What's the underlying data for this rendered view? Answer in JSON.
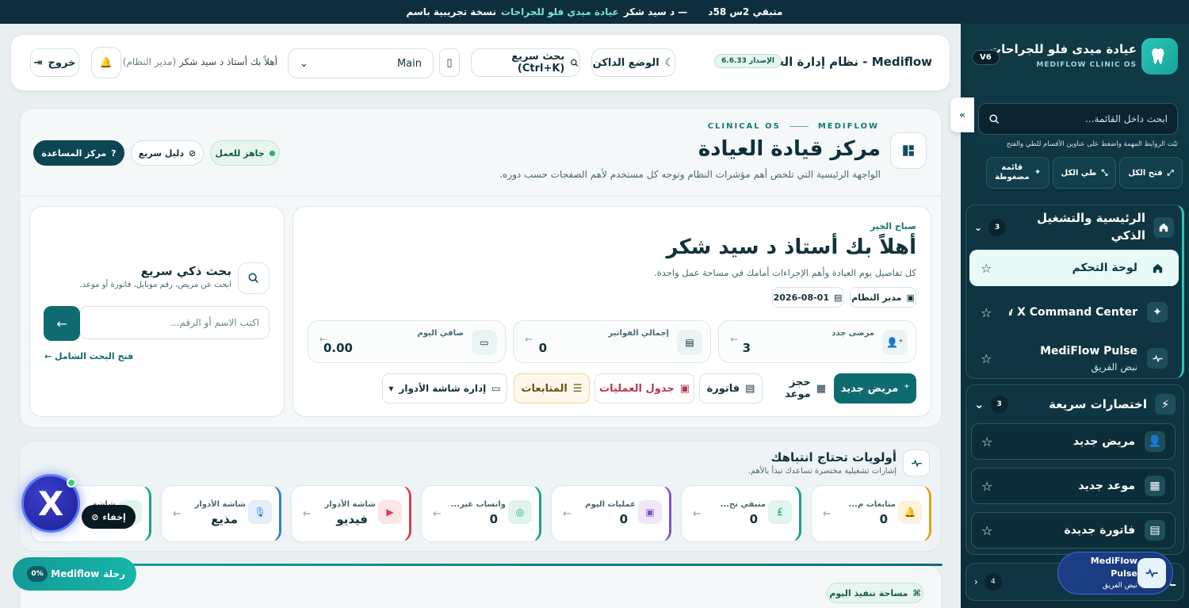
{
  "banner": {
    "prefix": "نسخة تجريبية باسم",
    "clinic": "عيادة ميدي فلو للجراحات",
    "user": "— د سيد شكر",
    "remaining": "متبقي 2س 58د"
  },
  "sidebar": {
    "title": "عيادة ميدى فلو للجراحات",
    "subtitle": "MEDIFLOW CLINIC OS",
    "version": "V6",
    "search_placeholder": "ابحث داخل القائمة...",
    "hint": "ثبّت الروابط المهمة واضغط على عناوين الأقسام للطي والفتح",
    "tools": {
      "expand": "فتح الكل",
      "collapse": "طي الكل",
      "compact": "قائمة مضغوطة"
    },
    "group1": {
      "title": "الرئيسية والتشغيل الذكي",
      "count": "3",
      "items": [
        {
          "label": "لوحة التحكم",
          "sub": ""
        },
        {
          "label": "MediFlow X Command Center",
          "sub": ""
        },
        {
          "label": "MediFlow Pulse",
          "sub": "نبض الفريق"
        }
      ]
    },
    "group2": {
      "title": "اختصارات سريعة",
      "count": "3",
      "items": [
        {
          "label": "مريض جديد"
        },
        {
          "label": "موعد جديد"
        },
        {
          "label": "فاتورة جديدة"
        }
      ]
    },
    "group3": {
      "title": "ـى",
      "count": "4"
    },
    "pulse_fab": {
      "title": "MediFlow Pulse",
      "sub": "نبض الفريق"
    }
  },
  "header": {
    "app_title": "Mediflow - نظام إدارة العيادة",
    "version_badge": "الإصدار 6.6.33",
    "dark_mode": "الوضع الداكن",
    "quick_search": "بحث سريع (Ctrl+K)",
    "branch": "Main",
    "welcome": "أهلاً بك أستاذ د سيد شكر",
    "role": "(مدير النظام)",
    "logout": "خروج"
  },
  "hero": {
    "eyebrow_left": "MEDIFLOW",
    "eyebrow_right": "CLINICAL OS",
    "title": "مركز قيادة العيادة",
    "subtitle": "الواجهة الرئيسية التي تلخص أهم مؤشرات النظام وتوجه كل مستخدم لأهم الصفحات حسب دوره.",
    "ready": "جاهز للعمل",
    "guide": "دليل سريع",
    "help": "مركز المساعدة"
  },
  "greeting": {
    "morning": "صباح الخير",
    "title": "أهلاً بك أستاذ د سيد شكر",
    "desc": "كل تفاصيل يوم العيادة وأهم الإجراءات أمامك في مساحة عمل واحدة.",
    "role_chip": "مدير النظام",
    "date_chip": "2026-08-01",
    "stats": [
      {
        "label": "مرضى جدد",
        "value": "3"
      },
      {
        "label": "إجمالي الفواتير",
        "value": "0"
      },
      {
        "label": "صافي اليوم",
        "value": "0.00"
      }
    ],
    "actions": {
      "new_patient": "مريض جديد",
      "book": "حجز موعد",
      "invoice": "فاتورة",
      "surgeries": "جدول العمليات",
      "followups": "المتابعات",
      "queue": "إدارة شاشة الأدوار"
    }
  },
  "smart_search": {
    "title": "بحث ذكي سريع",
    "desc": "ابحث عن مريض، رقم موبايل، فاتورة أو موعد.",
    "placeholder": "اكتب الاسم أو الرقم...",
    "full": "فتح البحث الشامل"
  },
  "priorities": {
    "title": "أولويات تحتاج انتباهك",
    "desc": "إشارات تشغيلية مختصرة تساعدك تبدأ بالأهم.",
    "items": [
      {
        "label": "متابعات م...",
        "value": "0",
        "color": "#e2a11a",
        "bg": "#fdf3dc"
      },
      {
        "label": "متبقي تح...",
        "value": "0",
        "color": "#1aa37a",
        "bg": "#e0f5ec"
      },
      {
        "label": "عمليات اليوم",
        "value": "0",
        "color": "#7a55c8",
        "bg": "#efe8fb"
      },
      {
        "label": "واتساب غير...",
        "value": "0",
        "color": "#1aa37a",
        "bg": "#e0f5ec"
      },
      {
        "label": "شاشة الأدوار",
        "value": "فيديو",
        "color": "#d9404a",
        "bg": "#fbe5e6"
      },
      {
        "label": "شاشة الأدوار",
        "value": "مذيع",
        "color": "#3b7bd9",
        "bg": "#e4eefc"
      },
      {
        "label": "شاشة",
        "value": "ي",
        "color": "#1aa37a",
        "bg": "#e0f5ec"
      }
    ]
  },
  "bottom": {
    "workspace": "مساحة تنفيذ اليوم"
  },
  "floating": {
    "hide": "إخفاء",
    "journey": "رحلة",
    "journey_brand": "Mediflow",
    "journey_pct": "0%"
  }
}
